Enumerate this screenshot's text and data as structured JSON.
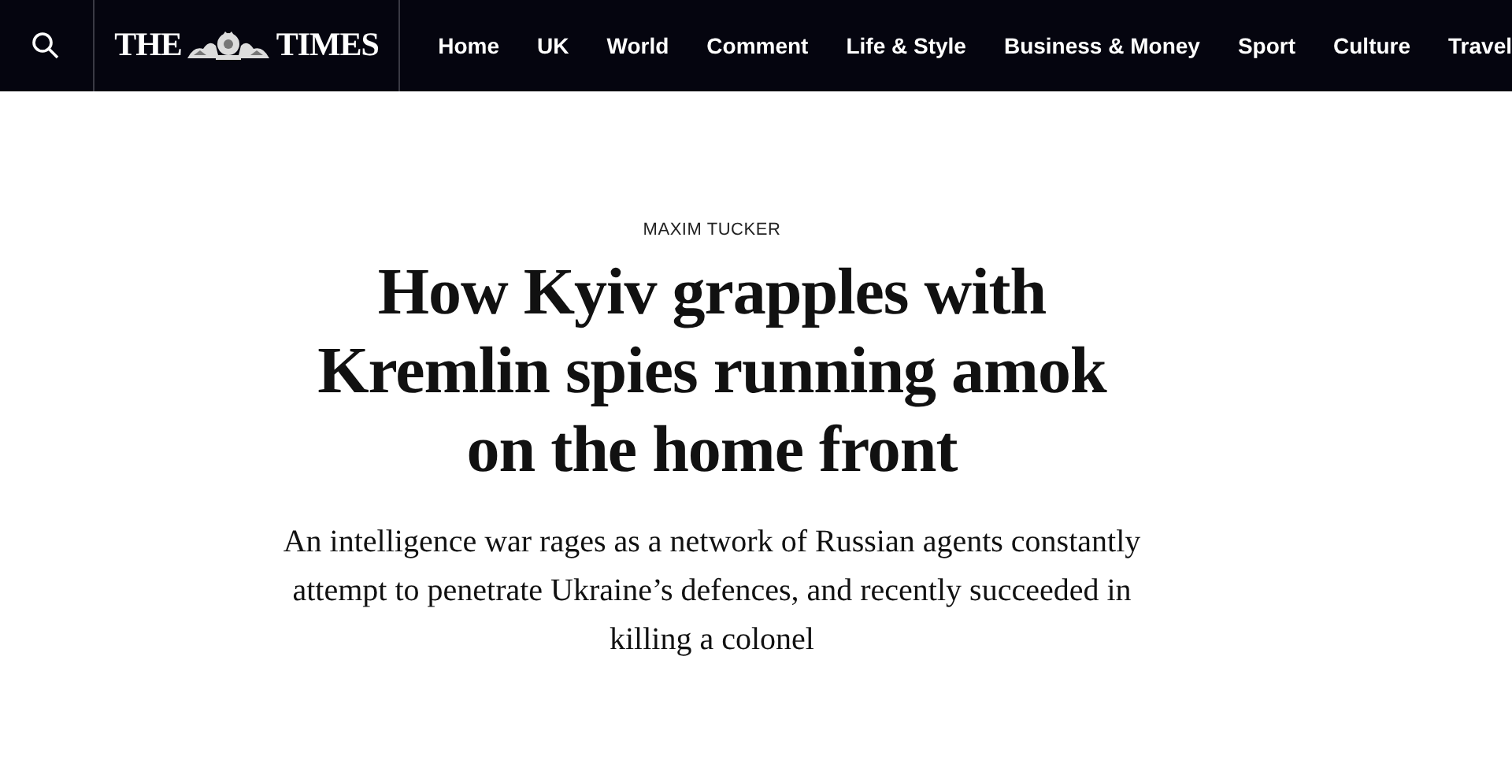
{
  "header": {
    "logo": {
      "left": "THE",
      "right": "TIMES"
    },
    "nav": [
      "Home",
      "UK",
      "World",
      "Comment",
      "Life & Style",
      "Business & Money",
      "Sport",
      "Culture",
      "Travel"
    ]
  },
  "article": {
    "byline": "MAXIM TUCKER",
    "headline": "How Kyiv grapples with Kremlin spies running amok on the home front",
    "standfirst": "An intelligence war rages as a network of Russian agents constantly attempt to penetrate Ukraine’s defences, and recently succeeded in killing a colonel"
  }
}
